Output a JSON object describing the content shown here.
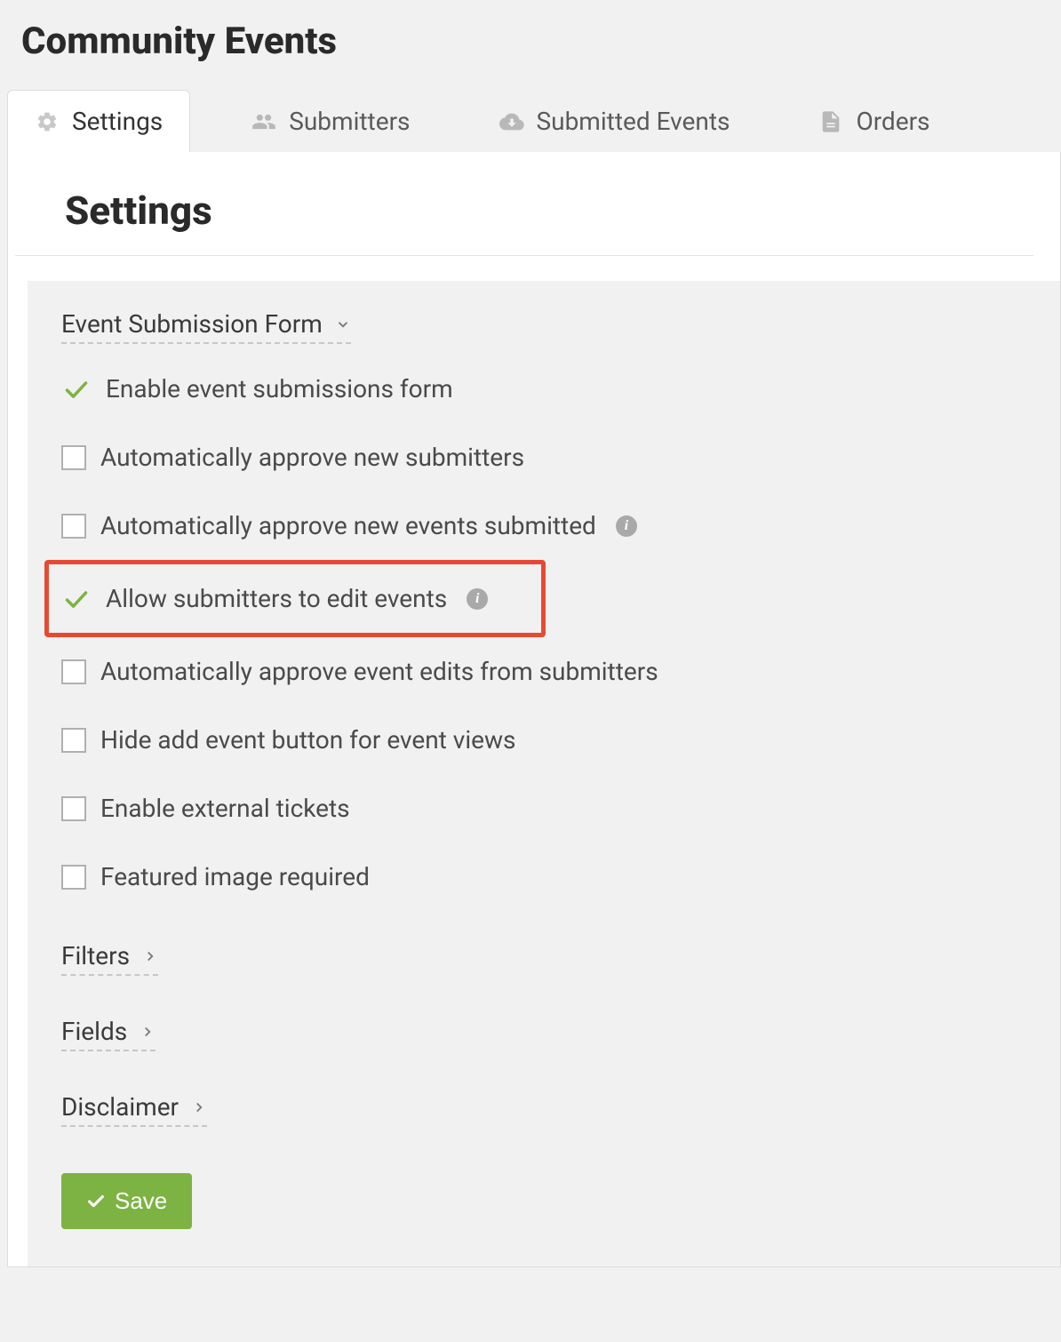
{
  "page_title": "Community Events",
  "tabs": [
    {
      "label": "Settings",
      "icon": "gear-icon",
      "active": true
    },
    {
      "label": "Submitters",
      "icon": "users-icon",
      "active": false
    },
    {
      "label": "Submitted Events",
      "icon": "cloud-download-icon",
      "active": false
    },
    {
      "label": "Orders",
      "icon": "document-icon",
      "active": false
    }
  ],
  "section_title": "Settings",
  "expander_main": "Event Submission Form",
  "options": [
    {
      "label": "Enable event submissions form",
      "checked": true,
      "info": false,
      "highlight": false
    },
    {
      "label": "Automatically approve new submitters",
      "checked": false,
      "info": false,
      "highlight": false
    },
    {
      "label": "Automatically approve new events submitted",
      "checked": false,
      "info": true,
      "highlight": false
    },
    {
      "label": "Allow submitters to edit events",
      "checked": true,
      "info": true,
      "highlight": true
    },
    {
      "label": "Automatically approve event edits from submitters",
      "checked": false,
      "info": false,
      "highlight": false
    },
    {
      "label": "Hide add event button for event views",
      "checked": false,
      "info": false,
      "highlight": false
    },
    {
      "label": "Enable external tickets",
      "checked": false,
      "info": false,
      "highlight": false
    },
    {
      "label": "Featured image required",
      "checked": false,
      "info": false,
      "highlight": false
    }
  ],
  "subexpanders": [
    {
      "label": "Filters"
    },
    {
      "label": "Fields"
    },
    {
      "label": "Disclaimer"
    }
  ],
  "save_label": "Save"
}
